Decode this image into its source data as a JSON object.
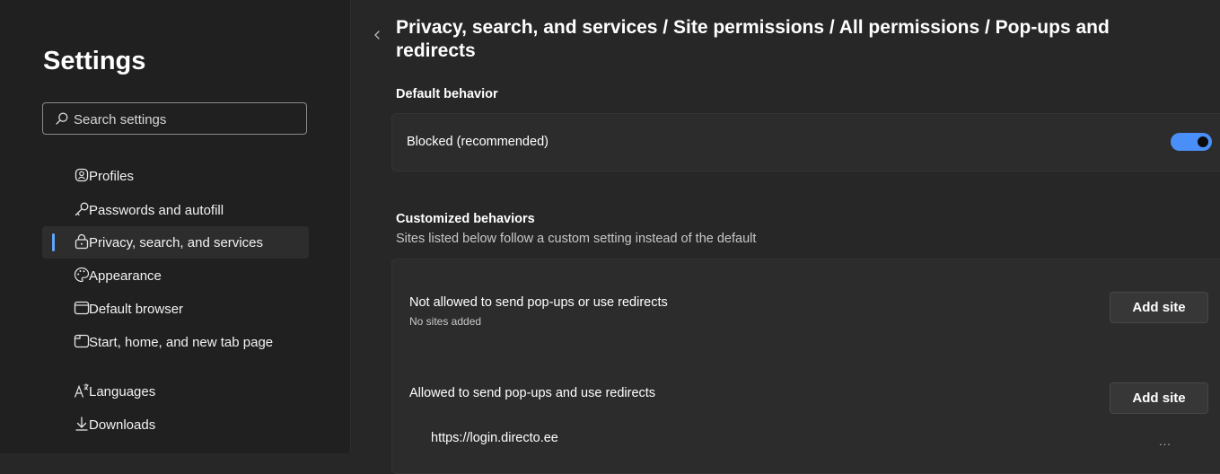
{
  "sidebar": {
    "title": "Settings",
    "search_placeholder": "Search settings",
    "items": [
      {
        "label": "Profiles",
        "icon": "profile-icon"
      },
      {
        "label": "Passwords and autofill",
        "icon": "key-icon"
      },
      {
        "label": "Privacy, search, and services",
        "icon": "lock-icon",
        "active": true
      },
      {
        "label": "Appearance",
        "icon": "palette-icon"
      },
      {
        "label": "Default browser",
        "icon": "browser-icon"
      },
      {
        "label": "Start, home, and new tab page",
        "icon": "home-tab-icon"
      },
      {
        "label": "Languages",
        "icon": "languages-icon"
      },
      {
        "label": "Downloads",
        "icon": "download-icon"
      }
    ]
  },
  "main": {
    "title": "Privacy, search, and services / Site permissions / All permissions / Pop-ups and redirects",
    "default_heading": "Default behavior",
    "default_row": {
      "label": "Blocked (recommended)",
      "enabled": true
    },
    "custom_heading": "Customized behaviors",
    "custom_sub": "Sites listed below follow a custom setting instead of the default",
    "not_allowed": {
      "label": "Not allowed to send pop-ups or use redirects",
      "sub": "No sites added",
      "button": "Add site"
    },
    "allowed": {
      "label": "Allowed to send pop-ups and use redirects",
      "button": "Add site",
      "sites": [
        "https://login.directo.ee"
      ],
      "more": "..."
    }
  },
  "colors": {
    "accent": "#60a5fa",
    "toggle": "#4a8ff7",
    "background": "#272727",
    "sidebar": "#202020"
  }
}
